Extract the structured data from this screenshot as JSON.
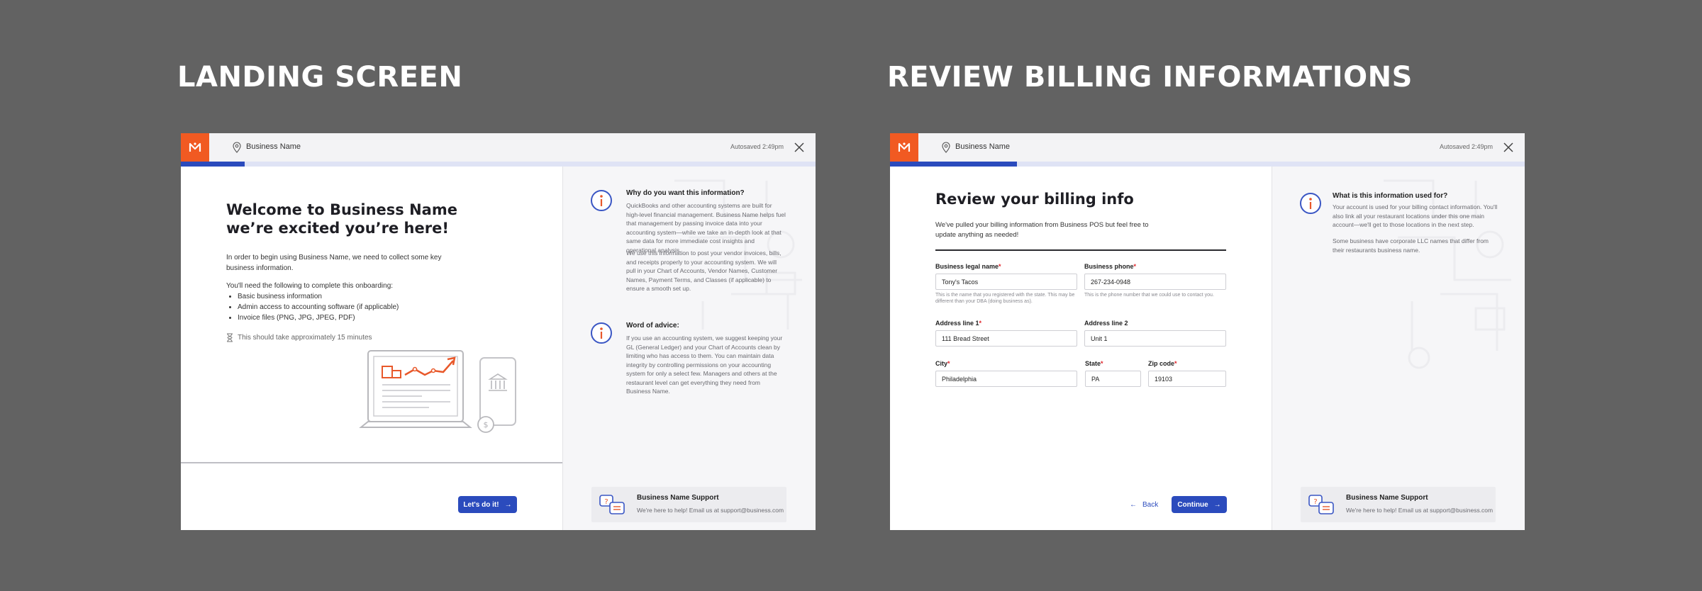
{
  "landing": {
    "section_title": "LANDING SCREEN",
    "header": {
      "business_name": "Business Name",
      "autosaved": "Autosaved 2:49pm"
    },
    "progress": 0.1,
    "main": {
      "title_line1": "Welcome to Business Name",
      "title_line2": "we’re excited you’re here!",
      "intro": "In order to begin using Business Name, we need to collect some key business information.",
      "need_heading": "You'll need the following to complete this onboarding:",
      "items": [
        "Basic business information",
        "Admin access to accounting software (if applicable)",
        "Invoice files (PNG, JPG, JPEG, PDF)"
      ],
      "time_note": "This should take approximately 15 minutes",
      "cta": "Let's do it!"
    },
    "info": [
      {
        "title": "Why do you want this information?",
        "paragraphs": [
          "QuickBooks and other accounting systems are built for high-level financial management. Business Name helps fuel that management by passing invoice data into your accounting system—while we take an in-depth look at that same data for more immediate cost insights and operational analysis.",
          "We use this information to post your vendor invoices, bills, and receipts properly to your accounting system. We will pull in your Chart of Accounts, Vendor Names, Customer Names, Payment Terms, and Classes (if applicable) to ensure a smooth set up."
        ]
      },
      {
        "title": "Word of advice:",
        "paragraphs": [
          "If you use an accounting system, we suggest keeping your GL (General Ledger) and your Chart of Accounts clean by limiting who has access to them. You can maintain data integrity by controlling permissions on your accounting system for only a select few. Managers and others at the restaurant level can get everything they need from Business Name."
        ]
      }
    ],
    "support": {
      "title": "Business Name Support",
      "text": "We're here to help! Email us at support@business.com"
    }
  },
  "billing": {
    "section_title": "REVIEW BILLING INFORMATIONS",
    "header": {
      "business_name": "Business Name",
      "autosaved": "Autosaved 2:49pm"
    },
    "progress": 0.2,
    "main": {
      "title": "Review your billing info",
      "intro": "We've pulled your billing information from Business POS but feel free to update anything as needed!",
      "fields": {
        "legal_name": {
          "label": "Business legal name",
          "value": "Tony's Tacos",
          "help": "This is the name that you registered with the state. This may be different than your DBA (doing business as)."
        },
        "phone": {
          "label": "Business phone",
          "value": "267-234-0948",
          "help": "This is the phone number that we could use to contact you."
        },
        "address1": {
          "label": "Address line 1",
          "value": "111 Bread Street"
        },
        "address2": {
          "label": "Address line 2",
          "value": "Unit 1"
        },
        "city": {
          "label": "City",
          "value": "Philadelphia"
        },
        "state": {
          "label": "State",
          "value": "PA"
        },
        "zip": {
          "label": "Zip code",
          "value": "19103"
        }
      },
      "back": "Back",
      "continue": "Continue"
    },
    "info": {
      "title": "What is this information used for?",
      "paragraphs": [
        "Your account is used for your billing contact information. You'll also link all your restaurant locations under this one main account—we'll get to those locations in the next step.",
        "Some business have corporate LLC names that differ from their restaurants business name."
      ]
    },
    "support": {
      "title": "Business Name Support",
      "text": "We're here to help! Email us at support@business.com"
    }
  },
  "colors": {
    "accent": "#2b4bbd",
    "brand": "#f15a22",
    "required": "#e0242a"
  }
}
